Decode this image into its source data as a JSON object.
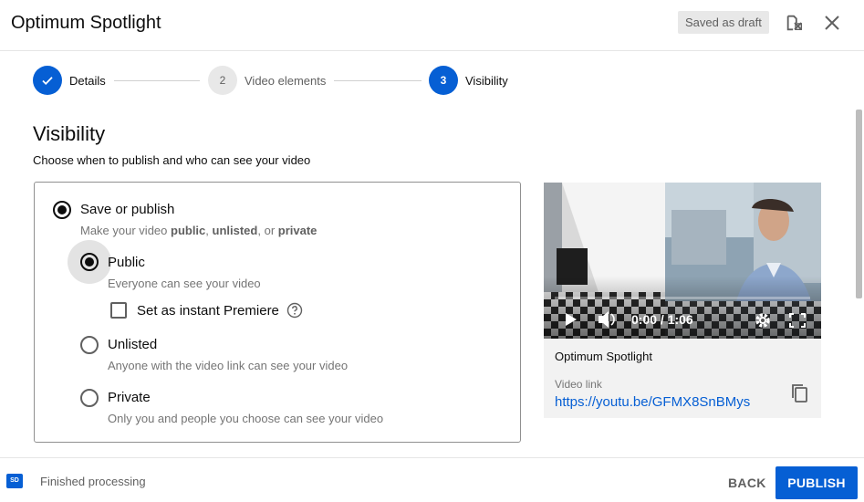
{
  "header": {
    "title": "Optimum Spotlight",
    "draft_badge": "Saved as draft"
  },
  "stepper": {
    "steps": [
      {
        "number": "",
        "label": "Details",
        "state": "done"
      },
      {
        "number": "2",
        "label": "Video elements",
        "state": "todo"
      },
      {
        "number": "3",
        "label": "Visibility",
        "state": "active"
      }
    ]
  },
  "visibility": {
    "title": "Visibility",
    "description": "Choose when to publish and who can see your video",
    "save_or_publish": {
      "label": "Save or publish",
      "desc_prefix": "Make your video ",
      "desc_public": "public",
      "desc_sep1": ", ",
      "desc_unlisted": "unlisted",
      "desc_sep2": ", or ",
      "desc_private": "private",
      "selected": true
    },
    "options": [
      {
        "label": "Public",
        "description": "Everyone can see your video",
        "selected": true
      },
      {
        "label": "Unlisted",
        "description": "Anyone with the video link can see your video",
        "selected": false
      },
      {
        "label": "Private",
        "description": "Only you and people you choose can see your video",
        "selected": false
      }
    ],
    "premiere": {
      "label": "Set as instant Premiere",
      "checked": false
    }
  },
  "video": {
    "time": "0:00 / 1:06",
    "title": "Optimum Spotlight",
    "link_label": "Video link",
    "link": "https://youtu.be/GFMX8SnBMys"
  },
  "footer": {
    "hd_badge": "SD",
    "status": "Finished processing",
    "back_label": "BACK",
    "publish_label": "PUBLISH"
  },
  "colors": {
    "accent": "#065fd4",
    "text": "#0d0d0d",
    "muted": "#606060"
  }
}
